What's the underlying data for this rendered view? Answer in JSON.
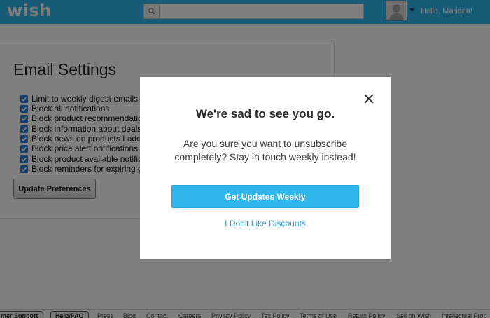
{
  "header": {
    "logo": "wish",
    "search": {
      "placeholder": "",
      "value": "",
      "icon": "search-icon"
    },
    "user": {
      "greeting": "Hello, Mariana!",
      "avatar_icon": "avatar-placeholder-icon"
    }
  },
  "settings": {
    "title": "Email Settings",
    "options": [
      {
        "label": "Limit to weekly digest emails",
        "checked": true
      },
      {
        "label": "Block all notifications",
        "checked": true
      },
      {
        "label": "Block product recommendation",
        "checked": true
      },
      {
        "label": "Block information about deals o",
        "checked": true
      },
      {
        "label": "Block news on products I adde",
        "checked": true
      },
      {
        "label": "Block price alert notifications",
        "checked": true
      },
      {
        "label": "Block product available notifica",
        "checked": true
      },
      {
        "label": "Block reminders for expiring gi",
        "checked": true
      }
    ],
    "update_button": "Update Preferences"
  },
  "footer": {
    "pills": [
      "mer Support",
      "Help/FAQ"
    ],
    "links": [
      "Press",
      "Blog",
      "Contact",
      "Careers",
      "Privacy Policy",
      "Tax Policy",
      "Terms of Use",
      "Return Policy",
      "Sell on Wish",
      "Intellectual Prop"
    ]
  },
  "modal": {
    "title": "We're sad to see you go.",
    "message": "Are you sure you want to unsubscribe completely? Stay in touch weekly instead!",
    "primary_button": "Get Updates Weekly",
    "secondary_link": "I Don't Like Discounts",
    "close_icon": "close-icon"
  },
  "colors": {
    "brand": "#2fb7ec",
    "checkbox": "#2f7fd4",
    "link": "#2fa4d6",
    "overlay": "rgba(0,0,0,0.5)"
  }
}
